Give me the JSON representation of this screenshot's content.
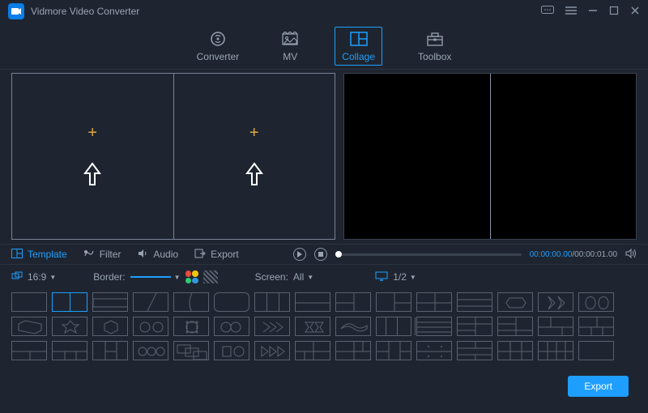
{
  "title": "Vidmore Video Converter",
  "tabs": {
    "converter": "Converter",
    "mv": "MV",
    "collage": "Collage",
    "toolbox": "Toolbox"
  },
  "mid_tabs": {
    "template": "Template",
    "filter": "Filter",
    "audio": "Audio",
    "export": "Export"
  },
  "player": {
    "current": "00:00:00.00",
    "total": "00:00:01.00"
  },
  "opts": {
    "ratio": "16:9",
    "border_label": "Border:",
    "screen_label": "Screen:",
    "screen_value": "All",
    "page": "1/2"
  },
  "export_label": "Export"
}
